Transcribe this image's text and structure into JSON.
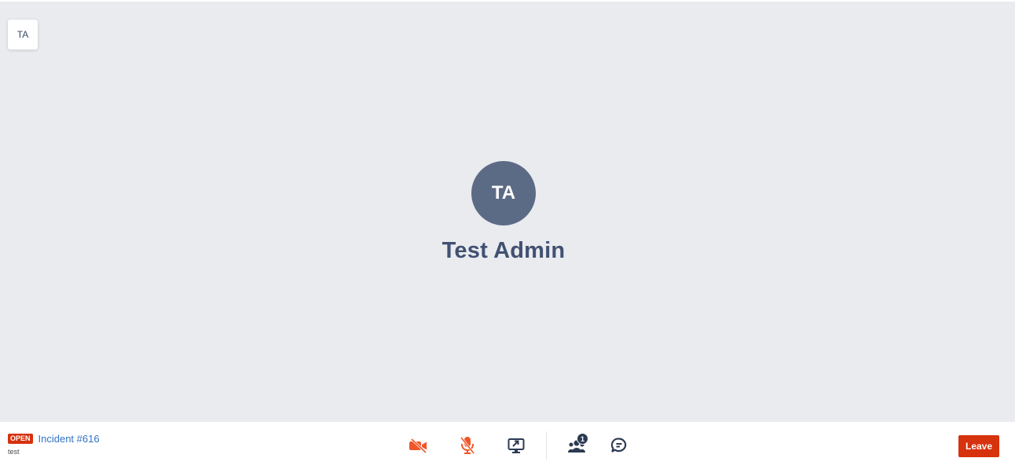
{
  "self_tile": {
    "initials": "TA"
  },
  "participant": {
    "initials": "TA",
    "name": "Test Admin"
  },
  "incident": {
    "status": "OPEN",
    "title": "Incident #616",
    "subtitle": "test"
  },
  "controls": {
    "camera_icon": "camera-off-icon",
    "mic_icon": "microphone-off-icon",
    "share_icon": "screen-share-icon",
    "participants_icon": "participants-icon",
    "participants_count": "1",
    "chat_icon": "chat-icon"
  },
  "leave_label": "Leave",
  "colors": {
    "accent_red": "#d6320d",
    "muted_orange": "#f0562b",
    "link_blue": "#3173c7",
    "avatar_bg": "#5c6b85",
    "stage_bg": "#e9ebef"
  }
}
